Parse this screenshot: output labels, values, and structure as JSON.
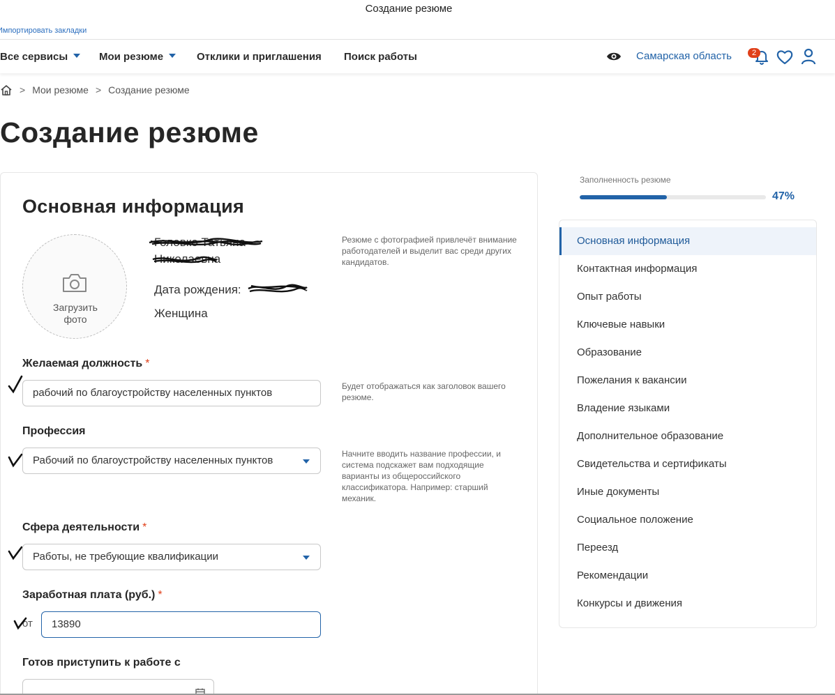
{
  "window": {
    "title": "Создание резюме"
  },
  "bookmarks": {
    "import_label": "Импортировать закладки"
  },
  "topnav": {
    "items": [
      {
        "label": "Все сервисы",
        "has_dropdown": true
      },
      {
        "label": "Мои резюме",
        "has_dropdown": true
      },
      {
        "label": "Отклики и приглашения",
        "has_dropdown": false
      },
      {
        "label": "Поиск работы",
        "has_dropdown": false
      }
    ],
    "region": "Самарская область",
    "notifications_count": "2",
    "icons": [
      "eye-icon",
      "bell-icon",
      "heart-icon",
      "user-icon"
    ]
  },
  "breadcrumb": {
    "home_icon": "home-icon",
    "separator": ">",
    "items": [
      "Мои резюме",
      "Создание резюме"
    ]
  },
  "page": {
    "title": "Создание резюме"
  },
  "main": {
    "section_title": "Основная информация",
    "photo": {
      "label": "Загрузить фото",
      "icon": "camera-icon"
    },
    "photo_hint": "Резюме с фотографией привлечёт внимание работодателей и выделит вас среди других кандидатов.",
    "person": {
      "name_line1": "Головко Татьяна",
      "name_line2": "Николаевна",
      "birth_label": "Дата рождения:",
      "gender": "Женщина"
    },
    "position": {
      "label": "Желаемая должность",
      "required_mark": "*",
      "value": "рабочий по благоустройству населенных пунктов",
      "hint": "Будет отображаться как заголовок вашего резюме."
    },
    "profession": {
      "label": "Профессия",
      "value": "Рабочий по благоустройству населенных пунктов",
      "hint": "Начните вводить название профессии, и система подскажет вам подходящие варианты из общероссийского классификатора. Например: старший механик."
    },
    "sphere": {
      "label": "Сфера деятельности",
      "required_mark": "*",
      "value": "Работы, не требующие квалификации"
    },
    "salary": {
      "label": "Заработная плата (руб.)",
      "required_mark": "*",
      "prefix": "от",
      "value": "13890"
    },
    "start_date": {
      "label": "Готов приступить к работе с",
      "icon": "calendar-icon"
    }
  },
  "progress": {
    "label": "Заполненность резюме",
    "value_text": "47%",
    "value": 0.47
  },
  "sidebar": {
    "items": [
      {
        "label": "Основная информация",
        "active": true
      },
      {
        "label": "Контактная информация",
        "active": false
      },
      {
        "label": "Опыт работы",
        "active": false
      },
      {
        "label": "Ключевые навыки",
        "active": false
      },
      {
        "label": "Образование",
        "active": false
      },
      {
        "label": "Пожелания к вакансии",
        "active": false
      },
      {
        "label": "Владение языками",
        "active": false
      },
      {
        "label": "Дополнительное образование",
        "active": false
      },
      {
        "label": "Свидетельства и сертификаты",
        "active": false
      },
      {
        "label": "Иные документы",
        "active": false
      },
      {
        "label": "Социальное положение",
        "active": false
      },
      {
        "label": "Переезд",
        "active": false
      },
      {
        "label": "Рекомендации",
        "active": false
      },
      {
        "label": "Конкурсы и движения",
        "active": false
      }
    ]
  },
  "colors": {
    "accent": "#2263a8",
    "required": "#e0401a",
    "badge": "#e0401a",
    "active_bg": "#eef3fa"
  }
}
